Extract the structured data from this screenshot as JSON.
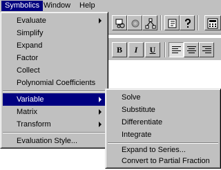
{
  "menubar": {
    "items": [
      {
        "label": "Symbolics",
        "active": true
      },
      {
        "label": "Window",
        "active": false
      },
      {
        "label": "Help",
        "active": false
      }
    ]
  },
  "symbolics_menu": {
    "items": [
      {
        "label": "Evaluate",
        "has_submenu": true
      },
      {
        "label": "Simplify"
      },
      {
        "label": "Expand"
      },
      {
        "label": "Factor"
      },
      {
        "label": "Collect"
      },
      {
        "label": "Polynomial Coefficients"
      },
      {
        "label": "Variable",
        "has_submenu": true,
        "highlighted": true
      },
      {
        "label": "Matrix",
        "has_submenu": true
      },
      {
        "label": "Transform",
        "has_submenu": true
      },
      {
        "label": "Evaluation Style..."
      }
    ]
  },
  "variable_submenu": {
    "items": [
      {
        "label": "Solve"
      },
      {
        "label": "Substitute"
      },
      {
        "label": "Differentiate"
      },
      {
        "label": "Integrate"
      },
      {
        "label": "Expand to Series..."
      },
      {
        "label": "Convert to Partial Fraction"
      }
    ]
  },
  "format_toolbar": {
    "bold": "B",
    "italic": "I",
    "underline": "U"
  },
  "colors": {
    "menu_face": "#c0c0c0",
    "highlight": "#000080",
    "highlight_text": "#ffffff"
  },
  "icons": [
    "copy-format-icon",
    "gear-icon",
    "network-icon",
    "book-icon",
    "help-icon",
    "calculator-icon",
    "align-left-icon",
    "align-center-icon",
    "align-right-icon",
    "submenu-arrow-icon"
  ]
}
